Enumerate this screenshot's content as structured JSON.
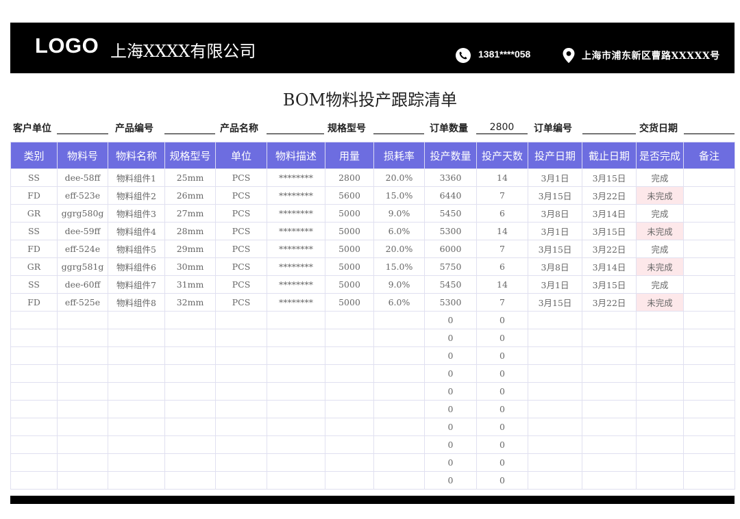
{
  "header": {
    "logo": "LOGO",
    "company": "上海XXXX有限公司",
    "phone": "1381****058",
    "address": "上海市浦东新区曹路XXXXX号",
    "phone_icon": "phone-icon",
    "location_icon": "location-pin-icon"
  },
  "title": "BOM物料投产跟踪清单",
  "info": {
    "customer_label": "客户单位",
    "customer_value": "",
    "product_no_label": "产品编号",
    "product_no_value": "",
    "product_name_label": "产品名称",
    "product_name_value": "",
    "spec_label": "规格型号",
    "spec_value": "",
    "order_qty_label": "订单数量",
    "order_qty_value": "2800",
    "order_no_label": "订单编号",
    "order_no_value": "",
    "delivery_label": "交货日期",
    "delivery_value": ""
  },
  "table": {
    "headers": [
      "类别",
      "物料号",
      "物料名称",
      "规格型号",
      "单位",
      "物料描述",
      "用量",
      "损耗率",
      "投产数量",
      "投产天数",
      "投产日期",
      "截止日期",
      "是否完成",
      "备注"
    ],
    "rows": [
      [
        "SS",
        "dee-58ff",
        "物料组件1",
        "25mm",
        "PCS",
        "********",
        "2800",
        "20.0%",
        "3360",
        "14",
        "3月1日",
        "3月15日",
        "完成",
        ""
      ],
      [
        "FD",
        "eff-523e",
        "物料组件2",
        "26mm",
        "PCS",
        "********",
        "5600",
        "15.0%",
        "6440",
        "7",
        "3月15日",
        "3月22日",
        "未完成",
        ""
      ],
      [
        "GR",
        "ggrg580g",
        "物料组件3",
        "27mm",
        "PCS",
        "********",
        "5000",
        "9.0%",
        "5450",
        "6",
        "3月8日",
        "3月14日",
        "完成",
        ""
      ],
      [
        "SS",
        "dee-59ff",
        "物料组件4",
        "28mm",
        "PCS",
        "********",
        "5000",
        "6.0%",
        "5300",
        "14",
        "3月1日",
        "3月15日",
        "未完成",
        ""
      ],
      [
        "FD",
        "eff-524e",
        "物料组件5",
        "29mm",
        "PCS",
        "********",
        "5000",
        "20.0%",
        "6000",
        "7",
        "3月15日",
        "3月22日",
        "完成",
        ""
      ],
      [
        "GR",
        "ggrg581g",
        "物料组件6",
        "30mm",
        "PCS",
        "********",
        "5000",
        "15.0%",
        "5750",
        "6",
        "3月8日",
        "3月14日",
        "未完成",
        ""
      ],
      [
        "SS",
        "dee-60ff",
        "物料组件7",
        "31mm",
        "PCS",
        "********",
        "5000",
        "9.0%",
        "5450",
        "14",
        "3月1日",
        "3月15日",
        "完成",
        ""
      ],
      [
        "FD",
        "eff-525e",
        "物料组件8",
        "32mm",
        "PCS",
        "********",
        "5000",
        "6.0%",
        "5300",
        "7",
        "3月15日",
        "3月22日",
        "未完成",
        ""
      ],
      [
        "",
        "",
        "",
        "",
        "",
        "",
        "",
        "",
        "0",
        "0",
        "",
        "",
        "",
        ""
      ],
      [
        "",
        "",
        "",
        "",
        "",
        "",
        "",
        "",
        "0",
        "0",
        "",
        "",
        "",
        ""
      ],
      [
        "",
        "",
        "",
        "",
        "",
        "",
        "",
        "",
        "0",
        "0",
        "",
        "",
        "",
        ""
      ],
      [
        "",
        "",
        "",
        "",
        "",
        "",
        "",
        "",
        "0",
        "0",
        "",
        "",
        "",
        ""
      ],
      [
        "",
        "",
        "",
        "",
        "",
        "",
        "",
        "",
        "0",
        "0",
        "",
        "",
        "",
        ""
      ],
      [
        "",
        "",
        "",
        "",
        "",
        "",
        "",
        "",
        "0",
        "0",
        "",
        "",
        "",
        ""
      ],
      [
        "",
        "",
        "",
        "",
        "",
        "",
        "",
        "",
        "0",
        "0",
        "",
        "",
        "",
        ""
      ],
      [
        "",
        "",
        "",
        "",
        "",
        "",
        "",
        "",
        "0",
        "0",
        "",
        "",
        "",
        ""
      ],
      [
        "",
        "",
        "",
        "",
        "",
        "",
        "",
        "",
        "0",
        "0",
        "",
        "",
        "",
        ""
      ],
      [
        "",
        "",
        "",
        "",
        "",
        "",
        "",
        "",
        "0",
        "0",
        "",
        "",
        "",
        ""
      ]
    ]
  },
  "colors": {
    "header_bg": "#000000",
    "table_header_bg": "#6d6de0",
    "incomplete_bg": "#fde8ea"
  }
}
